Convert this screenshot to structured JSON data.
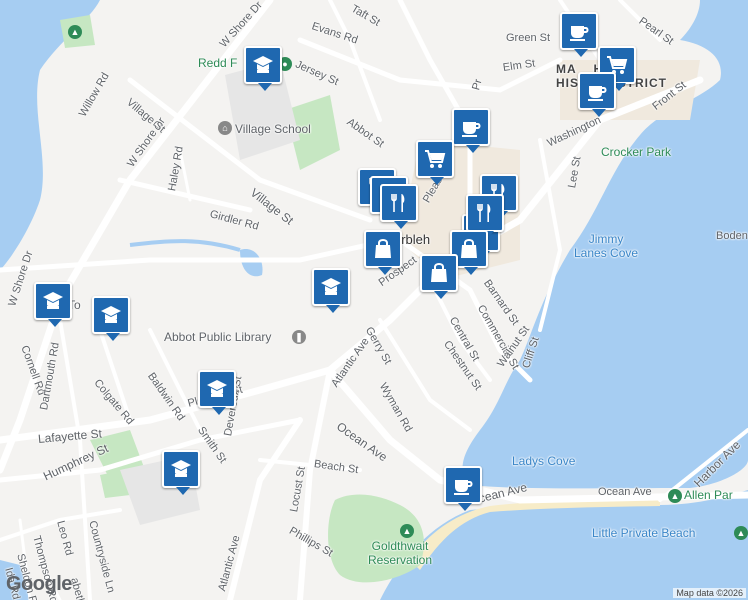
{
  "map": {
    "colors": {
      "land": "#f4f3f1",
      "water": "#a6cdf2",
      "park": "#c6e7c2",
      "beach": "#f7ecc8",
      "road": "#ffffff",
      "pin": "#1f68b0"
    },
    "streets": {
      "taft": "Taft St",
      "evans": "Evans Rd",
      "jersey": "Jersey St",
      "w_shore_dr_top": "W Shore Dr",
      "w_shore_dr_mid": "W Shore Dr",
      "w_shore_dr_left": "W Shore Dr",
      "willow": "Willow Rd",
      "village_st_top": "Village St",
      "village_st": "Village St",
      "abbot": "Abbot St",
      "haley": "Haley Rd",
      "girdler": "Girdler Rd",
      "green": "Green St",
      "elm": "Elm St",
      "pearl": "Pearl St",
      "front": "Front St",
      "washington": "Washington",
      "lee": "Lee St",
      "pleasant_top": "Pleas",
      "pleasant": "Pleasant St",
      "prospect": "Prospect",
      "gerry": "Gerry St",
      "central": "Central St",
      "commercial": "Commercial St",
      "barnard": "Barnard St",
      "chestnut": "Chestnut St",
      "walnut": "Walnut St",
      "cliff": "Cliff St",
      "atlantic_ave": "Atlantic Ave",
      "atlantic_ave_bottom": "Atlantic Ave",
      "wyman": "Wyman Rd",
      "ocean_ave_mid": "Ocean Ave",
      "ocean_ave_bottom": "Ocean Ave",
      "ocean_ave_right": "Ocean Ave",
      "harbor_ave": "Harbor Ave",
      "cornell": "Cornell Rd",
      "dartmouth": "Dartmouth Rd",
      "colgate": "Colgate Rd",
      "baldwin": "Baldwin Rd",
      "smith": "Smith St",
      "devereux": "Devereux St",
      "lafayette": "Lafayette St",
      "humphrey": "Humphrey St",
      "countryside": "Countryside Ln",
      "leo": "Leo Rd",
      "thompson": "Thompson Rd",
      "sheldon": "Sheldon Rd",
      "ida": "Ida Rd",
      "elizabeth": "abeth Rd",
      "beach": "Beach St",
      "locust": "Locust St",
      "phillips": "Phillips St",
      "pr": "Pr"
    },
    "places": {
      "redd_farm": "Redd F",
      "village_school": "Village School",
      "historic_district": "MA    HEAD\nHIST      ISTRICT",
      "crocker_park": "Crocker Park",
      "jimmy_lanes_cove": "Jimmy\nLanes Cove",
      "boden": "Boden",
      "marblehead": "arbleh",
      "town_school": "To      chool",
      "abbot_library": "Abbot Public Library",
      "ladys_cove": "Ladys Cove",
      "allen_park": "Allen Par",
      "little_private_beach": "Little Private Beach",
      "goldthwait": "Goldthwait\nReservation"
    },
    "pins": [
      {
        "name": "school-pin-redd",
        "icon": "school"
      },
      {
        "name": "coffee-pin-green-st",
        "icon": "coffee"
      },
      {
        "name": "grocery-pin-historic",
        "icon": "cart"
      },
      {
        "name": "coffee-pin-historic",
        "icon": "coffee"
      },
      {
        "name": "coffee-pin-abbot",
        "icon": "coffee"
      },
      {
        "name": "grocery-pin-center",
        "icon": "cart"
      },
      {
        "name": "restaurant-pin-1",
        "icon": "fork"
      },
      {
        "name": "restaurant-pin-2",
        "icon": "fork"
      },
      {
        "name": "restaurant-pin-3",
        "icon": "fork"
      },
      {
        "name": "restaurant-pin-east",
        "icon": "fork"
      },
      {
        "name": "grocery-pin-east",
        "icon": "cart"
      },
      {
        "name": "shopping-pin-1",
        "icon": "bag"
      },
      {
        "name": "restaurant-pin-south",
        "icon": "fork"
      },
      {
        "name": "shopping-pin-2",
        "icon": "bag"
      },
      {
        "name": "shopping-pin-3",
        "icon": "bag"
      },
      {
        "name": "school-pin-prospect",
        "icon": "school"
      },
      {
        "name": "school-pin-west",
        "icon": "school"
      },
      {
        "name": "school-pin-town",
        "icon": "school"
      },
      {
        "name": "school-pin-pleasant",
        "icon": "school"
      },
      {
        "name": "school-pin-humphrey",
        "icon": "school"
      },
      {
        "name": "coffee-pin-ocean-ave",
        "icon": "coffee"
      }
    ],
    "logo": "Google",
    "attribution": "Map data ©2026"
  }
}
